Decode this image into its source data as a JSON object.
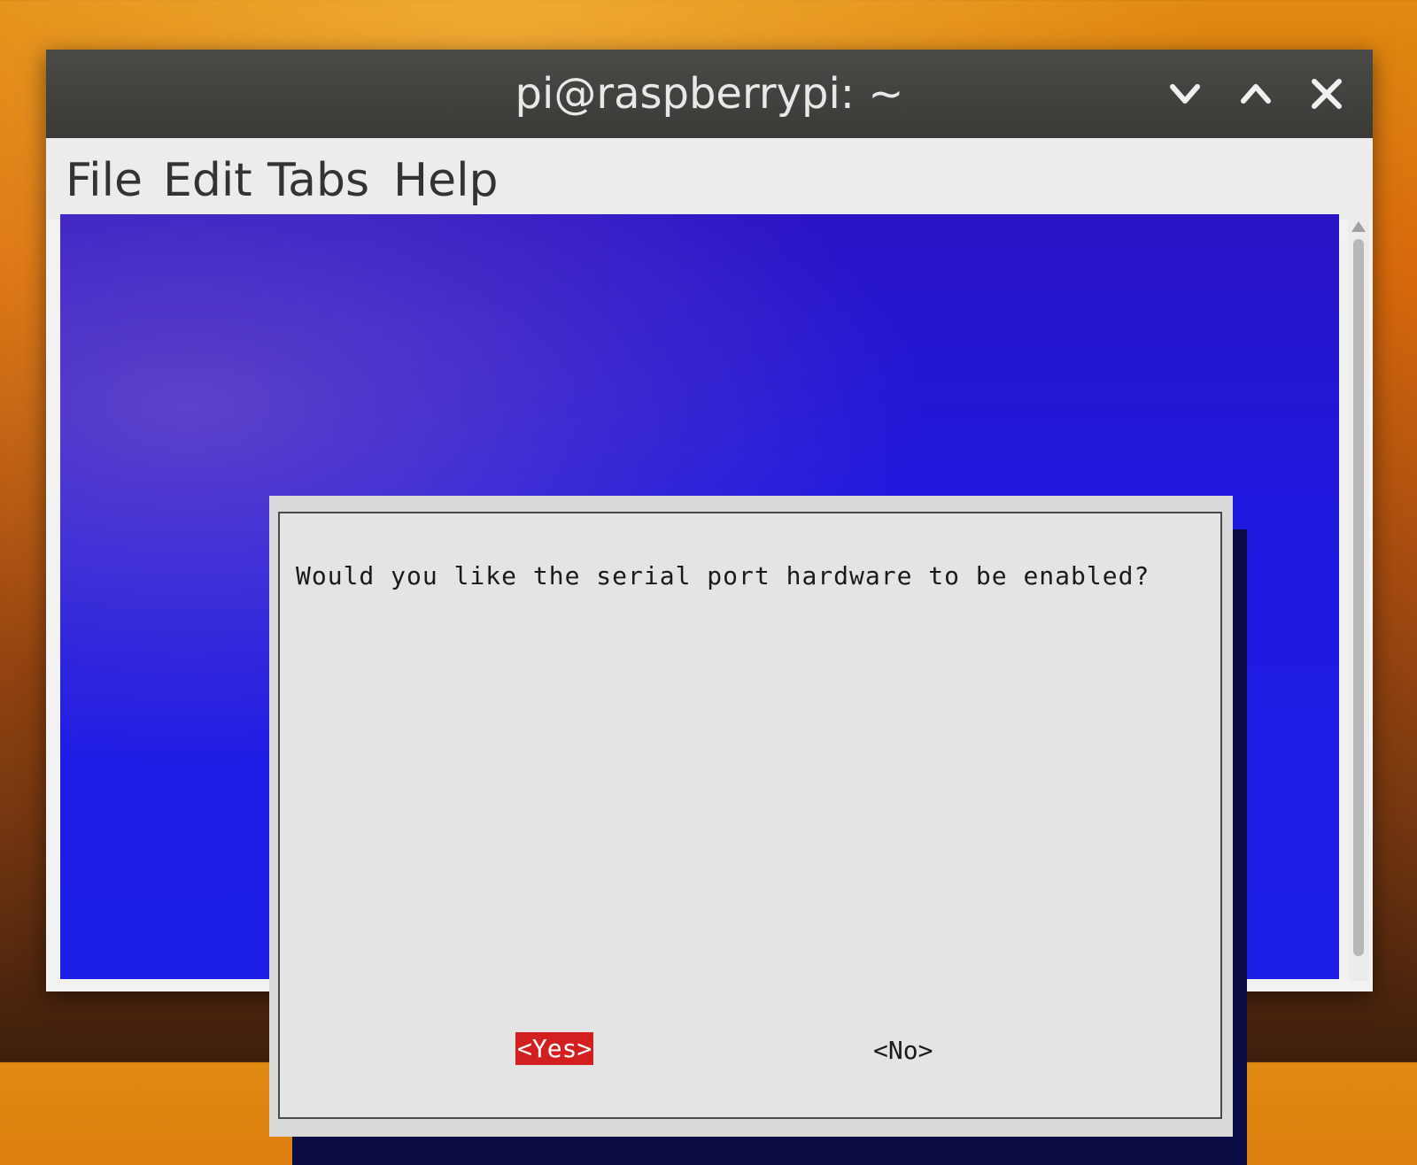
{
  "window": {
    "title": "pi@raspberrypi: ~",
    "controls": {
      "minimize_icon": "chevron-down-icon",
      "maximize_icon": "chevron-up-icon",
      "close_icon": "close-icon"
    }
  },
  "menubar": {
    "items": [
      "File",
      "Edit",
      "Tabs",
      "Help"
    ]
  },
  "dialog": {
    "message": "Would you like the serial port hardware to be enabled?",
    "yes_label": "<Yes>",
    "no_label": "<No>",
    "selected": "yes"
  },
  "colors": {
    "terminal_bg": "#1f19e0",
    "dialog_bg": "#e4e4e4",
    "selected_button_bg": "#d21f1f",
    "titlebar_bg": "#3a3a37"
  }
}
